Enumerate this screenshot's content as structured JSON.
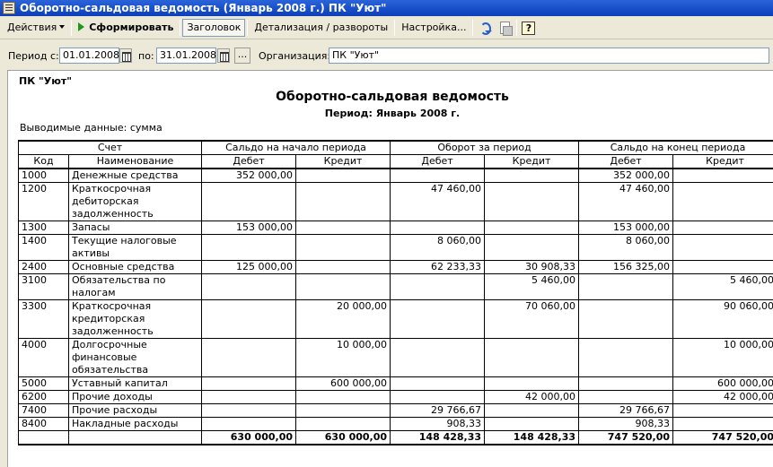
{
  "window": {
    "title": "Оборотно-сальдовая ведомость (Январь 2008 г.) ПК \"Уют\""
  },
  "toolbar": {
    "actions": "Действия",
    "generate": "Сформировать",
    "header": "Заголовок",
    "detail": "Детализация / развороты",
    "settings": "Настройка...",
    "help": "?"
  },
  "params": {
    "period_from_label": "Период с:",
    "period_from": "01.01.2008",
    "period_to_label": "по:",
    "period_to": "31.01.2008",
    "dots": "...",
    "org_label": "Организация:",
    "org_value": "ПК \"Уют\""
  },
  "report": {
    "org": "ПК \"Уют\"",
    "title": "Оборотно-сальдовая ведомость",
    "period": "Период: Январь 2008 г.",
    "output": "Выводимые данные:  сумма",
    "headers": {
      "account": "Счет",
      "opening": "Сальдо на начало периода",
      "turnover": "Оборот за период",
      "closing": "Сальдо на конец периода",
      "code": "Код",
      "name": "Наименование",
      "debit": "Дебет",
      "credit": "Кредит"
    },
    "rows": [
      {
        "code": "1000",
        "name": "Денежные средства",
        "od": "352 000,00",
        "oc": "",
        "td": "",
        "tc": "",
        "cd": "352 000,00",
        "cc": ""
      },
      {
        "code": "1200",
        "name": "Краткосрочная дебиторская задолженность",
        "od": "",
        "oc": "",
        "td": "47 460,00",
        "tc": "",
        "cd": "47 460,00",
        "cc": ""
      },
      {
        "code": "1300",
        "name": "Запасы",
        "od": "153 000,00",
        "oc": "",
        "td": "",
        "tc": "",
        "cd": "153 000,00",
        "cc": ""
      },
      {
        "code": "1400",
        "name": "Текущие налоговые активы",
        "od": "",
        "oc": "",
        "td": "8 060,00",
        "tc": "",
        "cd": "8 060,00",
        "cc": ""
      },
      {
        "code": "2400",
        "name": "Основные средства",
        "od": "125 000,00",
        "oc": "",
        "td": "62 233,33",
        "tc": "30 908,33",
        "cd": "156 325,00",
        "cc": ""
      },
      {
        "code": "3100",
        "name": "Обязательства по налогам",
        "od": "",
        "oc": "",
        "td": "",
        "tc": "5 460,00",
        "cd": "",
        "cc": "5 460,00"
      },
      {
        "code": "3300",
        "name": "Краткосрочная кредиторская задолженность",
        "od": "",
        "oc": "20 000,00",
        "td": "",
        "tc": "70 060,00",
        "cd": "",
        "cc": "90 060,00"
      },
      {
        "code": "4000",
        "name": "Долгосрочные финансовые обязательства",
        "od": "",
        "oc": "10 000,00",
        "td": "",
        "tc": "",
        "cd": "",
        "cc": "10 000,00"
      },
      {
        "code": "5000",
        "name": "Уставный капитал",
        "od": "",
        "oc": "600 000,00",
        "td": "",
        "tc": "",
        "cd": "",
        "cc": "600 000,00"
      },
      {
        "code": "6200",
        "name": "Прочие доходы",
        "od": "",
        "oc": "",
        "td": "",
        "tc": "42 000,00",
        "cd": "",
        "cc": "42 000,00"
      },
      {
        "code": "7400",
        "name": "Прочие расходы",
        "od": "",
        "oc": "",
        "td": "29 766,67",
        "tc": "",
        "cd": "29 766,67",
        "cc": ""
      },
      {
        "code": "8400",
        "name": "Накладные расходы",
        "od": "",
        "oc": "",
        "td": "908,33",
        "tc": "",
        "cd": "908,33",
        "cc": ""
      }
    ],
    "totals": {
      "od": "630 000,00",
      "oc": "630 000,00",
      "td": "148 428,33",
      "tc": "148 428,33",
      "cd": "747 520,00",
      "cc": "747 520,00"
    }
  }
}
